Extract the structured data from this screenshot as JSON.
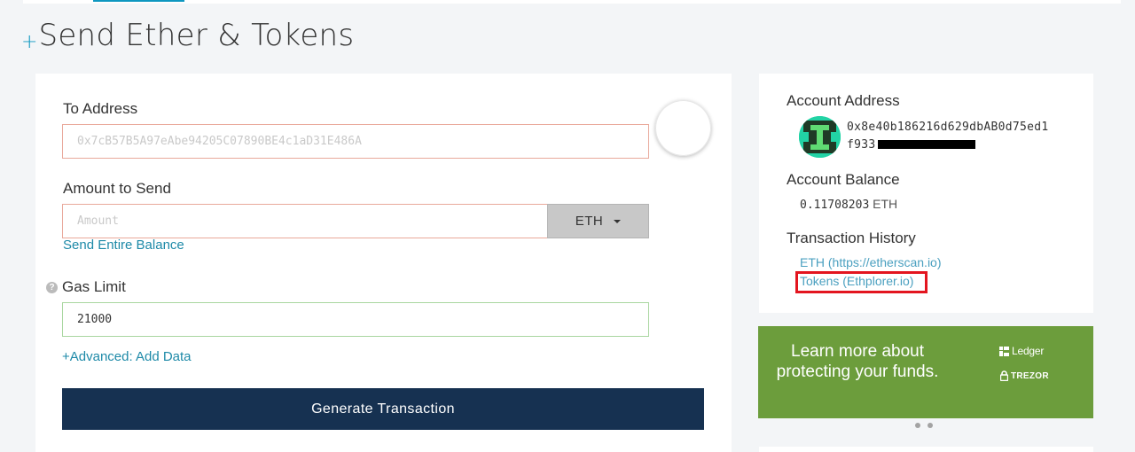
{
  "header": {
    "title_plus": "+",
    "title": "Send Ether & Tokens"
  },
  "form": {
    "to_address": {
      "label": "To Address",
      "placeholder": "0x7cB57B5A97eAbe94205C07890BE4c1aD31E486A"
    },
    "amount": {
      "label": "Amount to Send",
      "placeholder": "Amount",
      "unit": "ETH",
      "send_entire_balance": "Send Entire Balance"
    },
    "gas": {
      "help": "?",
      "label": "Gas Limit",
      "value": "21000"
    },
    "advanced_link": "+Advanced: Add Data",
    "generate_button": "Generate Transaction"
  },
  "sidebar": {
    "account_address_label": "Account Address",
    "address_line1": "0x8e40b186216d629dbAB0d75ed1",
    "address_line2": "f933",
    "account_balance_label": "Account Balance",
    "balance_value": "0.11708203",
    "balance_unit": "ETH",
    "tx_history_label": "Transaction History",
    "history_links": [
      "ETH (https://etherscan.io)",
      "Tokens (Ethplorer.io)"
    ]
  },
  "promo": {
    "text": "Learn more about protecting your funds.",
    "ledger": "Ledger",
    "trezor": "TREZOR",
    "color": "#6c9d3c"
  },
  "colors": {
    "accent": "#0e97c0",
    "button": "#163151",
    "error_border": "#e9a99b",
    "valid_border": "#a9d6a0",
    "highlight": "#e3151f"
  }
}
